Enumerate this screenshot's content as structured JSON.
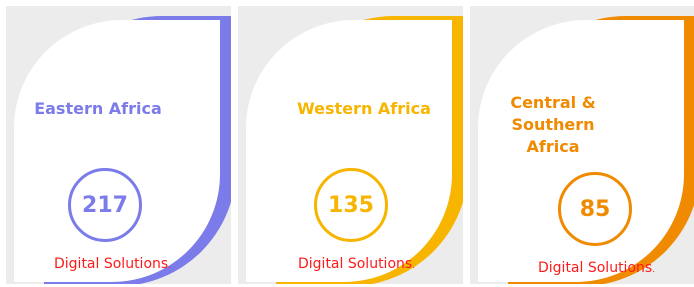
{
  "cards": [
    {
      "region": "Eastern  Africa",
      "count": "217",
      "caption": "Digital Solutions",
      "caption_tail": ".",
      "accent_color": "#7b7bea",
      "count_color": "#7b7bea",
      "region_color": "#7b7bea"
    },
    {
      "region": "Western Africa",
      "count": "135",
      "caption": "Digital Solutions",
      "caption_tail": ".",
      "accent_color": "#f7b500",
      "count_color": "#f7b500",
      "region_color": "#f7b500"
    },
    {
      "region_line1": "Central & Southern",
      "region_line2": "Africa",
      "count": "85",
      "caption": "Digital Solutions",
      "caption_tail": ".",
      "accent_color": "#f08a00",
      "count_color": "#f08a00",
      "region_color": "#f08a00"
    }
  ],
  "caption_color": "#ff1a1a",
  "card_background": "#ececec"
}
